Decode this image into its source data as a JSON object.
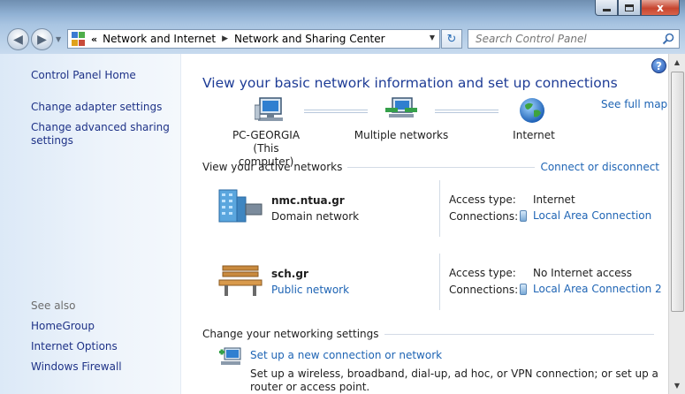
{
  "window": {
    "min_label": "",
    "max_label": "",
    "close_label": "x"
  },
  "address": {
    "overflow": "«",
    "crumbs": [
      "Network and Internet",
      "Network and Sharing Center"
    ],
    "search_placeholder": "Search Control Panel"
  },
  "left_pane": {
    "links": [
      "Control Panel Home",
      "Change adapter settings",
      "Change advanced sharing settings"
    ],
    "see_also_heading": "See also",
    "see_also": [
      "HomeGroup",
      "Internet Options",
      "Windows Firewall"
    ]
  },
  "main": {
    "title": "View your basic network information and set up connections",
    "see_full_map": "See full map",
    "map": {
      "computer_name": "PC-GEORGIA",
      "computer_sub": "(This computer)",
      "networks": "Multiple networks",
      "internet": "Internet"
    },
    "active_heading": "View your active networks",
    "connect_link": "Connect or disconnect",
    "networks": [
      {
        "name": "nmc.ntua.gr",
        "type": "Domain network",
        "access_label": "Access type:",
        "access_value": "Internet",
        "conn_label": "Connections:",
        "conn_value": "Local Area Connection"
      },
      {
        "name": "sch.gr",
        "type": "Public network",
        "access_label": "Access type:",
        "access_value": "No Internet access",
        "conn_label": "Connections:",
        "conn_value": "Local Area Connection 2"
      }
    ],
    "change_heading": "Change your networking settings",
    "tasks": [
      {
        "link": "Set up a new connection or network",
        "desc": "Set up a wireless, broadband, dial-up, ad hoc, or VPN connection; or set up a router or access point."
      }
    ]
  }
}
